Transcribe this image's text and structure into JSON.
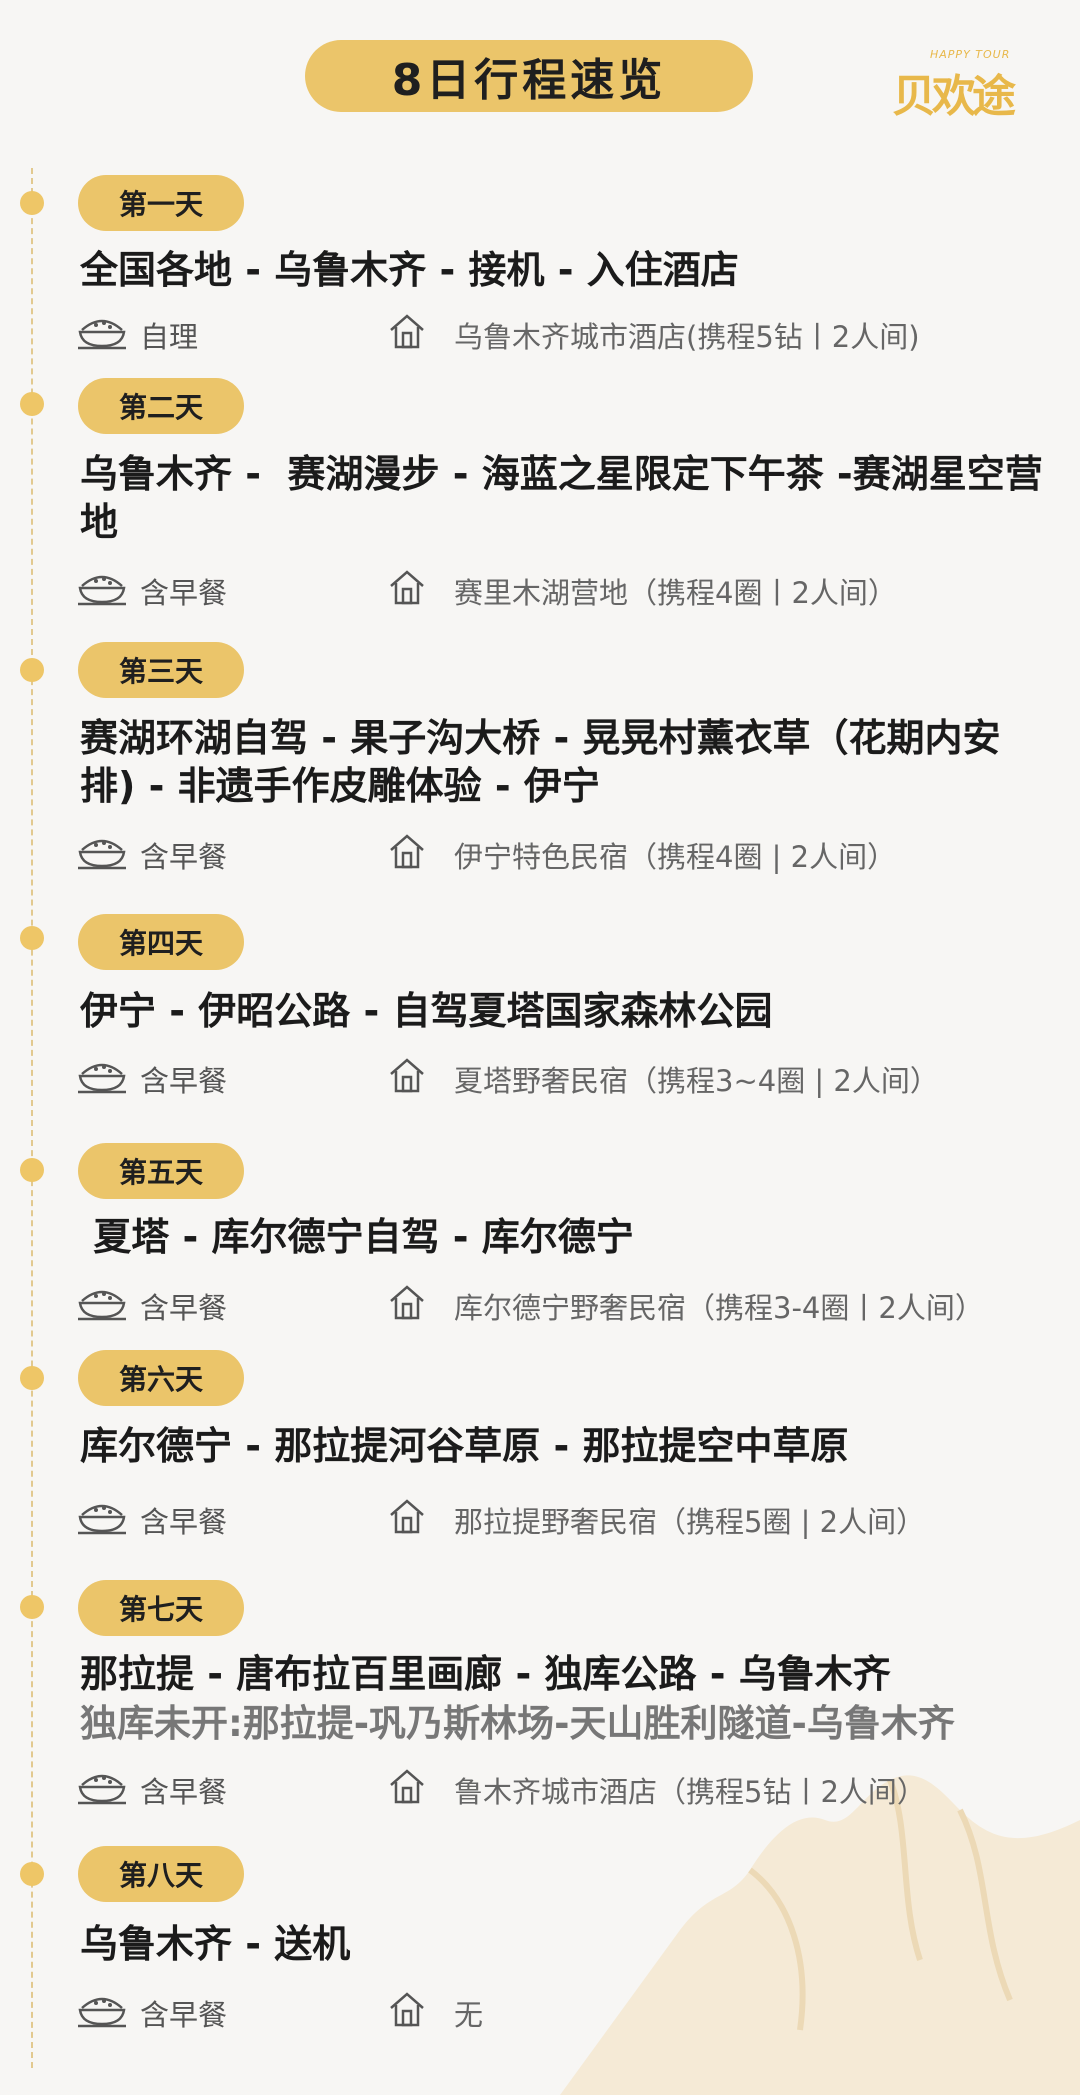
{
  "header": {
    "title": "8日行程速览",
    "logo_en": "HAPPY TOUR",
    "logo_zh": "贝欢途"
  },
  "colors": {
    "accent": "#ebc56a",
    "dot": "#eec667",
    "background": "#f7f6f4"
  },
  "days": [
    {
      "label": "第一天",
      "route": "全国各地 - 乌鲁木齐 - 接机 - 入住酒店",
      "meal": "自理",
      "hotel": "乌鲁木齐城市酒店(携程5钻丨2人间)"
    },
    {
      "label": "第二天",
      "route": "乌鲁木齐 -  赛湖漫步 - 海蓝之星限定下午茶 -赛湖星空营地",
      "meal": "含早餐",
      "hotel": "赛里木湖营地（携程4圈丨2人间）"
    },
    {
      "label": "第三天",
      "route": "赛湖环湖自驾 - 果子沟大桥 - 晃晃村薰衣草（花期内安排) - 非遗手作皮雕体验 - 伊宁",
      "meal": "含早餐",
      "hotel": "伊宁特色民宿（携程4圈 | 2人间）"
    },
    {
      "label": "第四天",
      "route": "伊宁 - 伊昭公路 - 自驾夏塔国家森林公园",
      "meal": "含早餐",
      "hotel": "夏塔野奢民宿（携程3~4圈 | 2人间）"
    },
    {
      "label": "第五天",
      "route": " 夏塔 - 库尔德宁自驾 - 库尔德宁",
      "meal": "含早餐",
      "hotel": "库尔德宁野奢民宿（携程3-4圈丨2人间）"
    },
    {
      "label": "第六天",
      "route": "库尔德宁 - 那拉提河谷草原 - 那拉提空中草原",
      "meal": "含早餐",
      "hotel": "那拉提野奢民宿（携程5圈 | 2人间）"
    },
    {
      "label": "第七天",
      "route": "那拉提 - 唐布拉百里画廊 - 独库公路 - 乌鲁木齐",
      "alt_route": "独库未开:那拉提-巩乃斯林场-天山胜利隧道-乌鲁木齐",
      "meal": "含早餐",
      "hotel": "鲁木齐城市酒店（携程5钻丨2人间）"
    },
    {
      "label": "第八天",
      "route": "乌鲁木齐 - 送机",
      "meal": "含早餐",
      "hotel": "无"
    }
  ]
}
